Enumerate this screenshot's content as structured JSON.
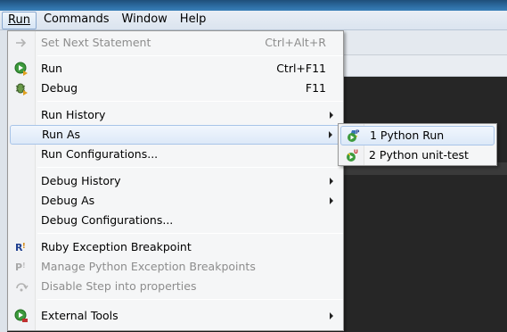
{
  "menubar": {
    "items": [
      {
        "label": "Run",
        "open": true
      },
      {
        "label": "Commands"
      },
      {
        "label": "Window"
      },
      {
        "label": "Help"
      }
    ]
  },
  "run_menu": {
    "set_next_statement": {
      "label": "Set Next Statement",
      "shortcut": "Ctrl+Alt+R",
      "icon": "arrow-right-icon"
    },
    "run": {
      "label": "Run",
      "shortcut": "Ctrl+F11",
      "icon": "run-icon"
    },
    "debug": {
      "label": "Debug",
      "shortcut": "F11",
      "icon": "debug-icon"
    },
    "run_history": {
      "label": "Run History"
    },
    "run_as": {
      "label": "Run As"
    },
    "run_configurations": {
      "label": "Run Configurations..."
    },
    "debug_history": {
      "label": "Debug History"
    },
    "debug_as": {
      "label": "Debug As"
    },
    "debug_configurations": {
      "label": "Debug Configurations..."
    },
    "ruby_exception_breakpoint": {
      "label": "Ruby Exception Breakpoint",
      "icon": "ruby-breakpoint-icon"
    },
    "manage_python_exception_breakpoints": {
      "label": "Manage Python Exception Breakpoints",
      "icon": "python-breakpoint-icon"
    },
    "disable_step_into_properties": {
      "label": "Disable Step into properties",
      "icon": "step-into-icon"
    },
    "external_tools": {
      "label": "External Tools",
      "icon": "external-tools-icon"
    }
  },
  "run_as_submenu": {
    "items": [
      {
        "label": "1 Python Run",
        "icon": "python-run-icon",
        "badge": "P"
      },
      {
        "label": "2 Python unit-test",
        "icon": "python-unittest-icon",
        "badge": "U"
      }
    ]
  },
  "colors": {
    "menu_bg": "#f5f6f7",
    "hover_bg": "#dde9f8",
    "hover_border": "#a8c4e8",
    "disabled_text": "#8d8d8d",
    "editor_bg": "#262626"
  }
}
